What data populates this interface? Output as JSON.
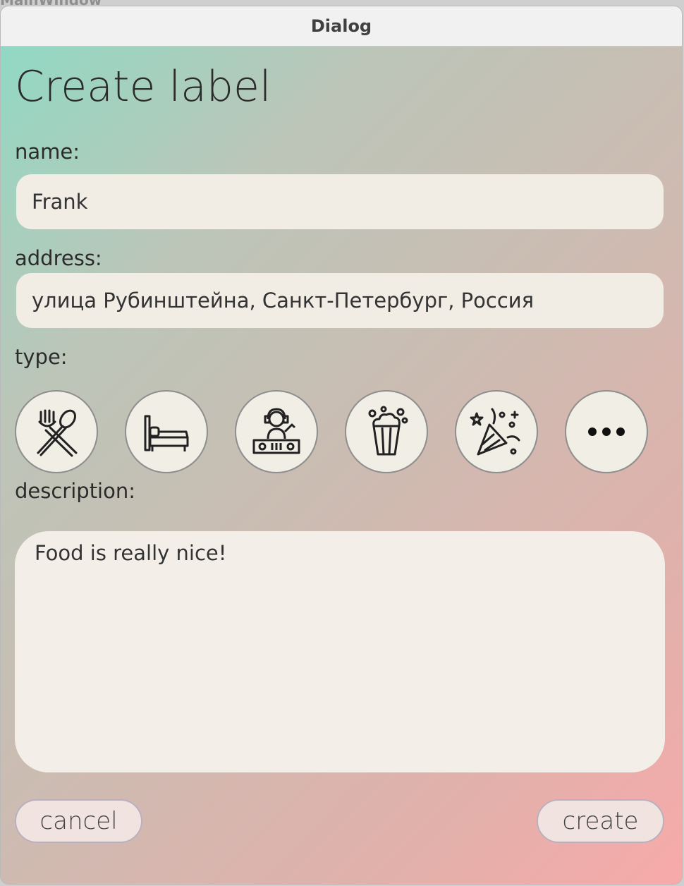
{
  "background_window_title": "MainWindow",
  "window": {
    "title": "Dialog"
  },
  "dialog": {
    "heading": "Create label",
    "name": {
      "label": "name:",
      "value": "Frank"
    },
    "address": {
      "label": "address:",
      "value": "улица Рубинштейна, Санкт-Петербург, Россия"
    },
    "type": {
      "label": "type:",
      "options": [
        {
          "icon": "fork-spoon-icon"
        },
        {
          "icon": "bed-icon"
        },
        {
          "icon": "dj-icon"
        },
        {
          "icon": "popcorn-icon"
        },
        {
          "icon": "party-popper-icon"
        },
        {
          "icon": "more-icon"
        }
      ]
    },
    "description": {
      "label": "description:",
      "value": "Food is really nice!"
    },
    "buttons": {
      "cancel": "cancel",
      "create": "create"
    }
  },
  "colors": {
    "gradient_start": "#91d9c4",
    "gradient_end": "#f7aaa9",
    "field_bg": "#f1ede4",
    "text": "#2b2b2b"
  }
}
